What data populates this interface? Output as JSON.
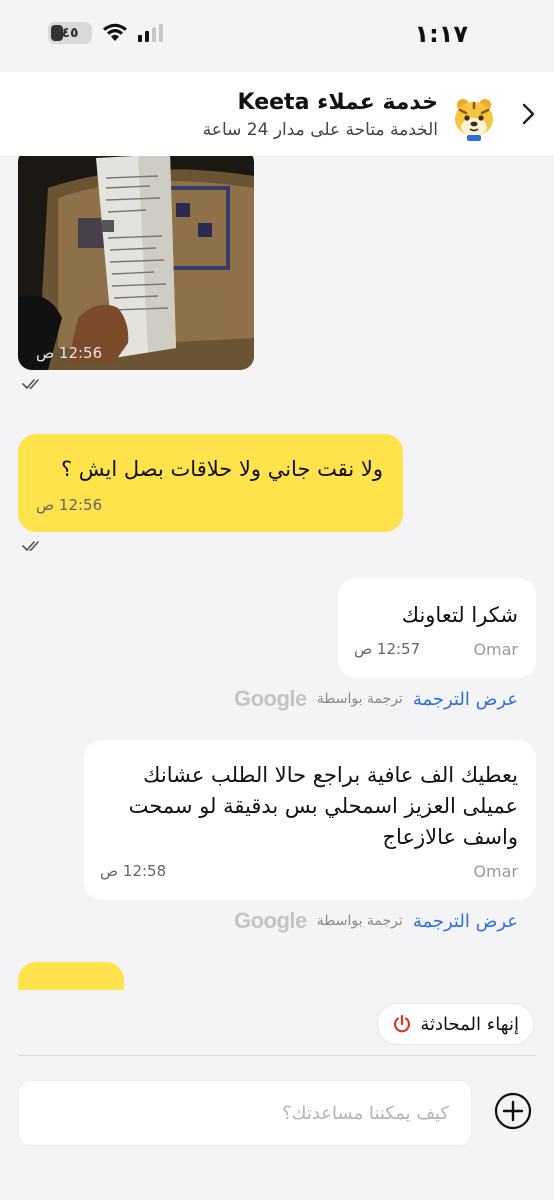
{
  "status_bar": {
    "time": "١:١٧",
    "battery_level": "٤٥"
  },
  "header": {
    "title": "خدمة عملاء Keeta",
    "subtitle": "الخدمة متاحة على مدار 24 ساعة"
  },
  "messages": [
    {
      "type": "image",
      "side": "outgoing",
      "time": "12:56 ص",
      "status": "read"
    },
    {
      "type": "text",
      "side": "outgoing",
      "text": "ولا نقت جاني ولا حلاقات بصل ايش ؟",
      "time": "12:56 ص",
      "status": "read"
    },
    {
      "type": "text",
      "side": "incoming",
      "text": "شكرا لتعاونك",
      "sender": "Omar",
      "time": "12:57 ص",
      "translation": {
        "link": "عرض الترجمة",
        "by": "ترجمة بواسطة",
        "provider": "Google"
      }
    },
    {
      "type": "text",
      "side": "incoming",
      "lines": [
        "يعطيك الف عافية براجع حالا الطلب عشانك",
        "عميلى العزيز اسمحلي بس بدقيقة لو سمحت",
        "واسف عالازعاج"
      ],
      "sender": "Omar",
      "time": "12:58 ص",
      "translation": {
        "link": "عرض الترجمة",
        "by": "ترجمة بواسطة",
        "provider": "Google"
      }
    }
  ],
  "actions": {
    "end_chat": "إنهاء المحادثة"
  },
  "composer": {
    "placeholder": "كيف يمكننا مساعدتك؟"
  },
  "colors": {
    "outgoing_bubble": "#ffe34c",
    "incoming_bubble": "#ffffff",
    "link": "#2f6fe0",
    "end_icon": "#e0342b"
  }
}
